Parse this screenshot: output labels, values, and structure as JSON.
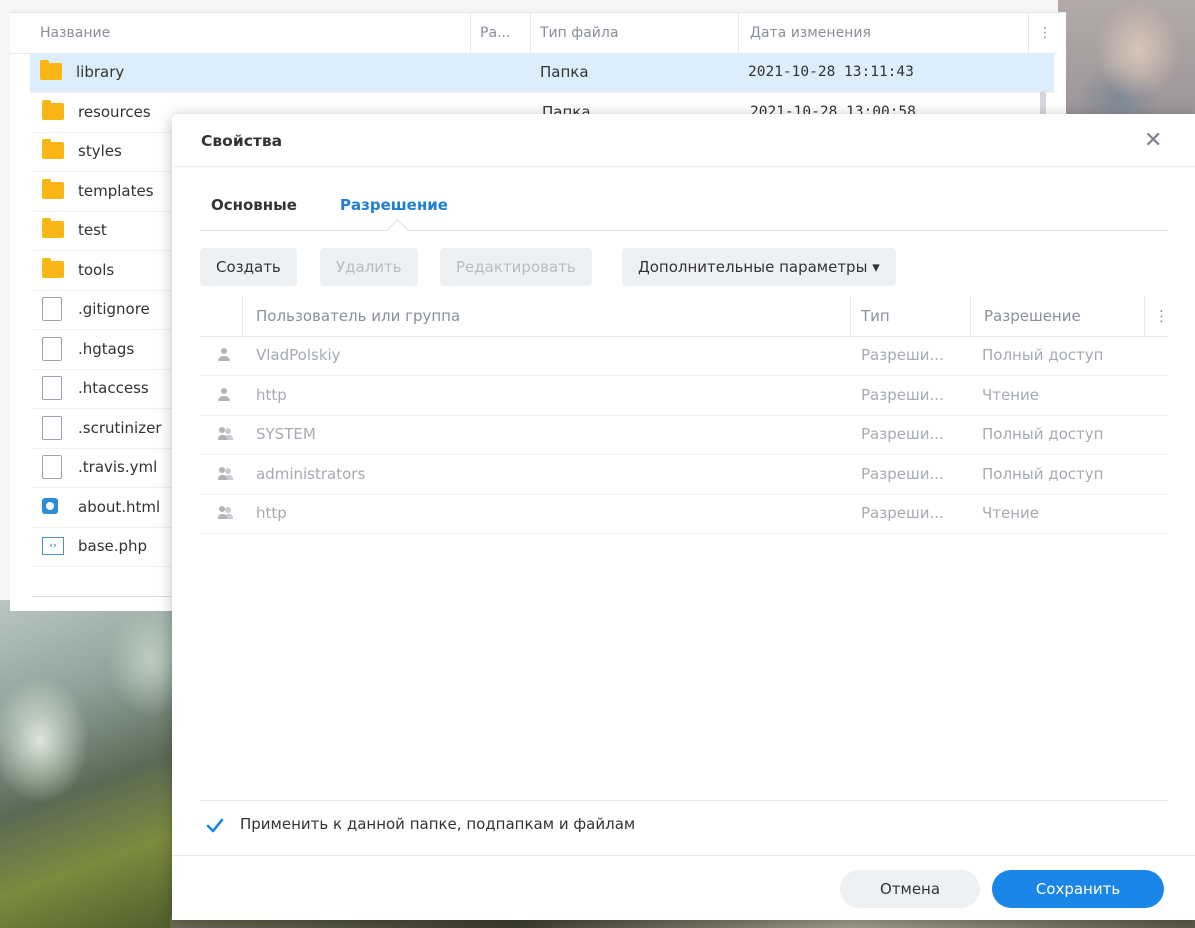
{
  "browser": {
    "columns": {
      "name": "Название",
      "size": "Ра...",
      "type": "Тип файла",
      "modified": "Дата изменения"
    },
    "rows": [
      {
        "icon": "folder-icon",
        "name": "library",
        "type": "Папка",
        "modified": "2021-10-28 13:11:43",
        "selected": true
      },
      {
        "icon": "folder-icon",
        "name": "resources",
        "type": "Папка",
        "modified": "2021-10-28 13:00:58"
      },
      {
        "icon": "folder-icon",
        "name": "styles"
      },
      {
        "icon": "folder-icon",
        "name": "templates"
      },
      {
        "icon": "folder-icon",
        "name": "test"
      },
      {
        "icon": "folder-icon",
        "name": "tools"
      },
      {
        "icon": "file-icon",
        "name": ".gitignore"
      },
      {
        "icon": "file-icon",
        "name": ".hgtags"
      },
      {
        "icon": "file-icon",
        "name": ".htaccess"
      },
      {
        "icon": "file-icon",
        "name": ".scrutinizer"
      },
      {
        "icon": "file-icon",
        "name": ".travis.yml"
      },
      {
        "icon": "html-file-icon",
        "name": "about.html"
      },
      {
        "icon": "php-file-icon",
        "name": "base.php"
      }
    ]
  },
  "dialog": {
    "title": "Свойства",
    "close_icon": "close-icon",
    "tabs": [
      {
        "label": "Основные",
        "active": false
      },
      {
        "label": "Разрешение",
        "active": true
      }
    ],
    "toolbar": {
      "create": "Создать",
      "delete": "Удалить",
      "edit": "Редактировать",
      "advanced": "Дополнительные параметры ▾"
    },
    "grid": {
      "columns": {
        "user": "Пользователь или группа",
        "type": "Тип",
        "permission": "Разрешение"
      },
      "rows": [
        {
          "icon": "user-icon",
          "user": "VladPolskiy",
          "type": "Разреши...",
          "permission": "Полный доступ"
        },
        {
          "icon": "user-icon",
          "user": "http",
          "type": "Разреши...",
          "permission": "Чтение"
        },
        {
          "icon": "group-icon",
          "user": "SYSTEM",
          "type": "Разреши...",
          "permission": "Полный доступ"
        },
        {
          "icon": "group-icon",
          "user": "administrators",
          "type": "Разреши...",
          "permission": "Полный доступ"
        },
        {
          "icon": "group-icon",
          "user": "http",
          "type": "Разреши...",
          "permission": "Чтение"
        }
      ]
    },
    "apply_checkbox": {
      "label": "Применить к данной папке, подпапкам и файлам",
      "checked": true
    },
    "buttons": {
      "cancel": "Отмена",
      "save": "Сохранить"
    }
  },
  "colors": {
    "accent": "#1a86e8",
    "folder": "#f9b615",
    "selected_row": "#dceefb"
  }
}
